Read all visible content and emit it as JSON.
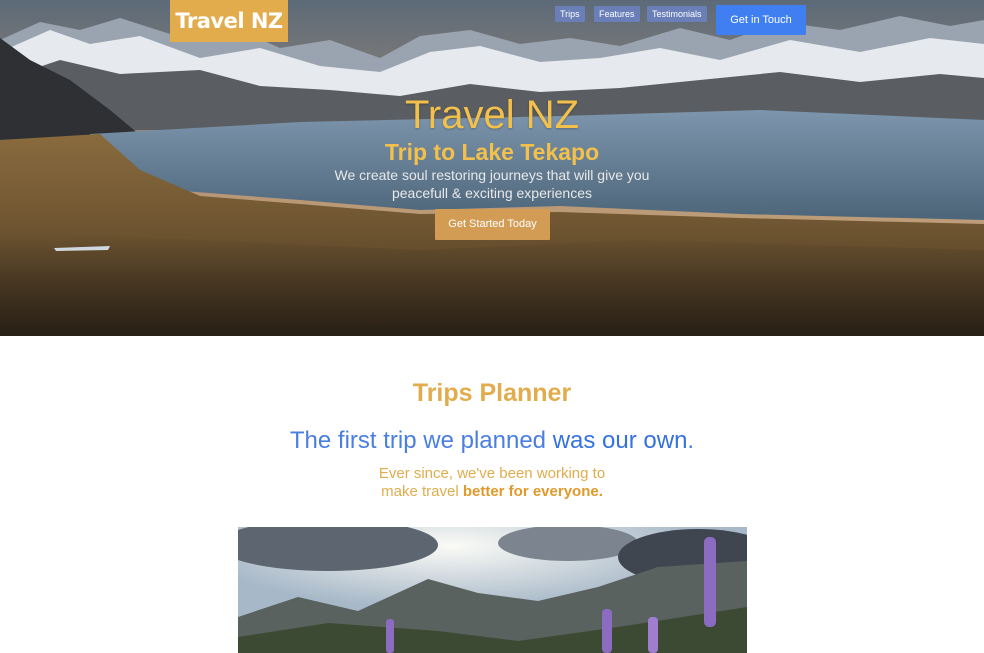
{
  "brand": {
    "logo_text": "Travel NZ",
    "accent": "#e2ac4d"
  },
  "nav": {
    "links": [
      "Trips",
      "Features",
      "Testimonials"
    ],
    "cta": "Get in Touch"
  },
  "hero": {
    "title": "Travel NZ",
    "subtitle": "Trip to Lake Tekapo",
    "tagline": "We create soul restoring journeys that will give you peacefull & exciting experiences",
    "cta": "Get Started Today"
  },
  "planner": {
    "title": "Trips Planner",
    "headline_plain": "The first trip we planned ",
    "headline_strong": "was our own",
    "headline_end": ".",
    "subline_plain": "Ever since, we've been working to make travel ",
    "subline_strong": "better for everyone."
  }
}
